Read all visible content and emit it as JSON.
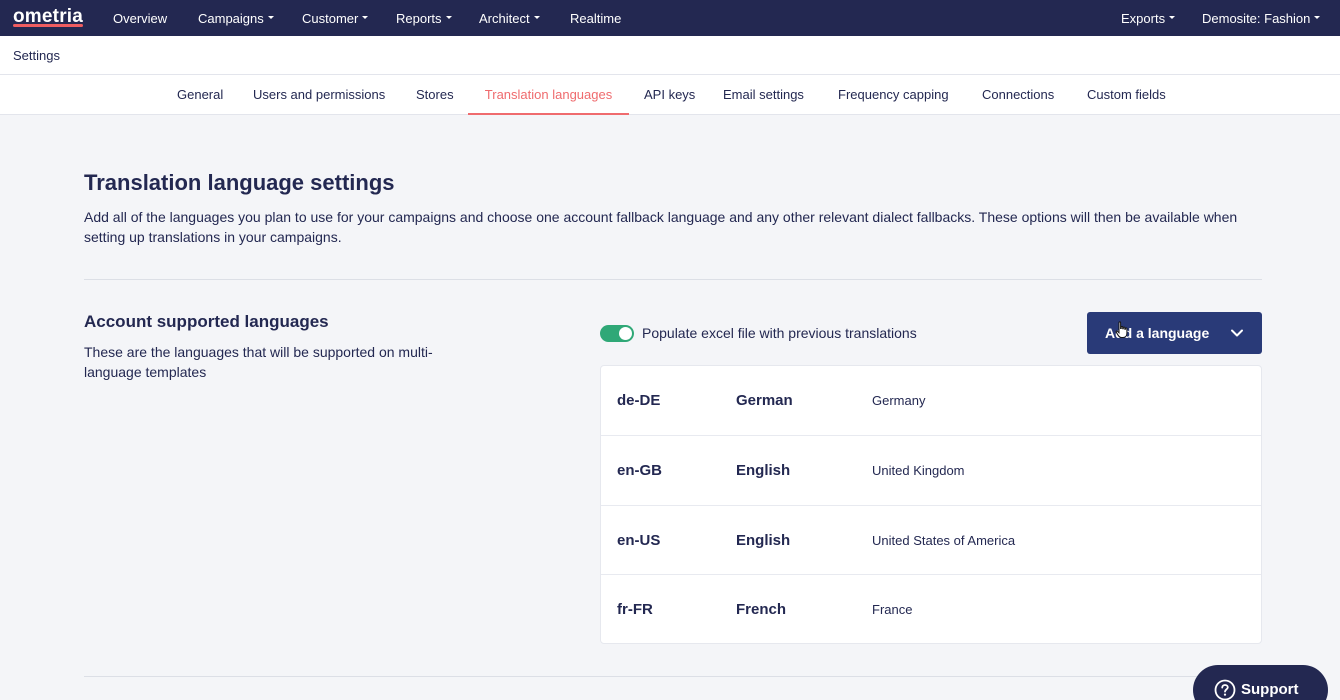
{
  "app": {
    "logo_text": "ometria"
  },
  "topnav": {
    "items": [
      {
        "label": "Overview",
        "has_caret": false
      },
      {
        "label": "Campaigns",
        "has_caret": true
      },
      {
        "label": "Customer",
        "has_caret": true
      },
      {
        "label": "Reports",
        "has_caret": true
      },
      {
        "label": "Architect",
        "has_caret": true
      },
      {
        "label": "Realtime",
        "has_caret": false
      }
    ],
    "exports_label": "Exports",
    "site_label": "Demosite: Fashion"
  },
  "page": {
    "section_title": "Settings"
  },
  "tabs": [
    {
      "label": "General",
      "active": false
    },
    {
      "label": "Users and permissions",
      "active": false
    },
    {
      "label": "Stores",
      "active": false
    },
    {
      "label": "Translation languages",
      "active": true
    },
    {
      "label": "API keys",
      "active": false
    },
    {
      "label": "Email settings",
      "active": false
    },
    {
      "label": "Frequency capping",
      "active": false
    },
    {
      "label": "Connections",
      "active": false
    },
    {
      "label": "Custom fields",
      "active": false
    }
  ],
  "main": {
    "title": "Translation language settings",
    "description": "Add all of the languages you plan to use for your campaigns and choose one account fallback language and any other relevant dialect fallbacks. These options will then be available when setting up translations in your campaigns."
  },
  "supported": {
    "title": "Account supported languages",
    "subtitle": "These are the languages that will be supported on multi-language templates",
    "toggle_label": "Populate excel file with previous translations",
    "toggle_on": true,
    "add_button_label": "Add a language",
    "languages": [
      {
        "code": "de-DE",
        "name": "German",
        "country": "Germany"
      },
      {
        "code": "en-GB",
        "name": "English",
        "country": "United Kingdom"
      },
      {
        "code": "en-US",
        "name": "English",
        "country": "United States of America"
      },
      {
        "code": "fr-FR",
        "name": "French",
        "country": "France"
      }
    ]
  },
  "support": {
    "label": "Support"
  },
  "colors": {
    "navy": "#232851",
    "accent": "#ef6b6e",
    "button": "#293a78",
    "toggle_on": "#2fa877",
    "background": "#f4f5f8"
  }
}
